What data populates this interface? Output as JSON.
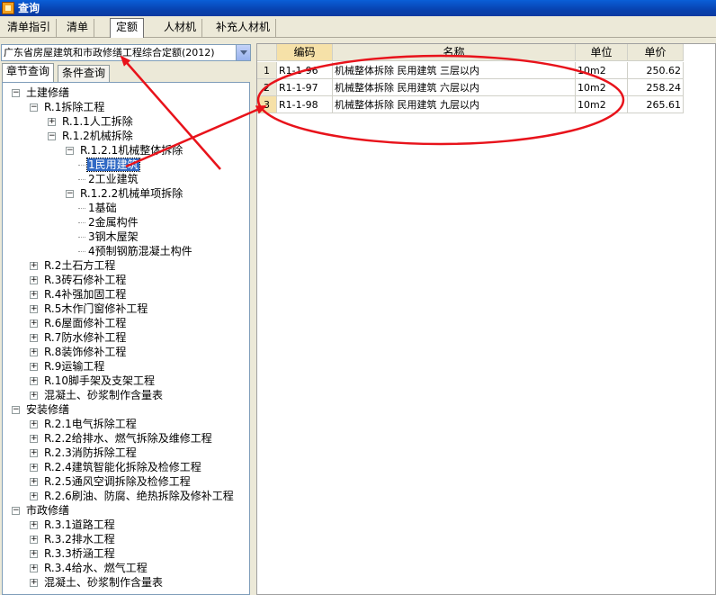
{
  "window": {
    "title": "查询",
    "icon": "app-icon"
  },
  "tabs": [
    "清单指引",
    "清单",
    "定额",
    "人材机",
    "补充人材机"
  ],
  "active_tab": "定额",
  "left": {
    "combo_value": "广东省房屋建筑和市政修缮工程综合定额(2012)",
    "subtabs": [
      "章节查询",
      "条件查询"
    ],
    "tree": [
      {
        "label": "土建修缮",
        "level": 0,
        "box": "-"
      },
      {
        "label": "R.1拆除工程",
        "level": 1,
        "box": "-"
      },
      {
        "label": "R.1.1人工拆除",
        "level": 2,
        "box": "+"
      },
      {
        "label": "R.1.2机械拆除",
        "level": 2,
        "box": "-"
      },
      {
        "label": "R.1.2.1机械整体拆除",
        "level": 3,
        "box": "-"
      },
      {
        "label": "1民用建筑",
        "level": 4,
        "box": "",
        "selected": true
      },
      {
        "label": "2工业建筑",
        "level": 4,
        "box": ""
      },
      {
        "label": "R.1.2.2机械单项拆除",
        "level": 3,
        "box": "-"
      },
      {
        "label": "1基础",
        "level": 4,
        "box": ""
      },
      {
        "label": "2金属构件",
        "level": 4,
        "box": ""
      },
      {
        "label": "3钢木屋架",
        "level": 4,
        "box": ""
      },
      {
        "label": "4预制钢筋混凝土构件",
        "level": 4,
        "box": ""
      },
      {
        "label": "R.2土石方工程",
        "level": 1,
        "box": "+"
      },
      {
        "label": "R.3砖石修补工程",
        "level": 1,
        "box": "+"
      },
      {
        "label": "R.4补强加固工程",
        "level": 1,
        "box": "+"
      },
      {
        "label": "R.5木作门窗修补工程",
        "level": 1,
        "box": "+"
      },
      {
        "label": "R.6屋面修补工程",
        "level": 1,
        "box": "+"
      },
      {
        "label": "R.7防水修补工程",
        "level": 1,
        "box": "+"
      },
      {
        "label": "R.8装饰修补工程",
        "level": 1,
        "box": "+"
      },
      {
        "label": "R.9运输工程",
        "level": 1,
        "box": "+"
      },
      {
        "label": "R.10脚手架及支架工程",
        "level": 1,
        "box": "+"
      },
      {
        "label": "混凝土、砂浆制作含量表",
        "level": 1,
        "box": "+"
      },
      {
        "label": "安装修缮",
        "level": 0,
        "box": "-"
      },
      {
        "label": "R.2.1电气拆除工程",
        "level": 1,
        "box": "+"
      },
      {
        "label": "R.2.2给排水、燃气拆除及维修工程",
        "level": 1,
        "box": "+"
      },
      {
        "label": "R.2.3消防拆除工程",
        "level": 1,
        "box": "+"
      },
      {
        "label": "R.2.4建筑智能化拆除及检修工程",
        "level": 1,
        "box": "+"
      },
      {
        "label": "R.2.5通风空调拆除及检修工程",
        "level": 1,
        "box": "+"
      },
      {
        "label": "R.2.6刷油、防腐、绝热拆除及修补工程",
        "level": 1,
        "box": "+"
      },
      {
        "label": "市政修缮",
        "level": 0,
        "box": "-"
      },
      {
        "label": "R.3.1道路工程",
        "level": 1,
        "box": "+"
      },
      {
        "label": "R.3.2排水工程",
        "level": 1,
        "box": "+"
      },
      {
        "label": "R.3.3桥涵工程",
        "level": 1,
        "box": "+"
      },
      {
        "label": "R.3.4给水、燃气工程",
        "level": 1,
        "box": "+"
      },
      {
        "label": "混凝土、砂浆制作含量表",
        "level": 1,
        "box": "+"
      }
    ]
  },
  "grid": {
    "columns": [
      "编码",
      "名称",
      "单位",
      "单价"
    ],
    "rows": [
      {
        "num": "1",
        "code": "R1-1-96",
        "name": "机械整体拆除 民用建筑 三层以内",
        "unit": "10m2",
        "price": "250.62"
      },
      {
        "num": "2",
        "code": "R1-1-97",
        "name": "机械整体拆除 民用建筑 六层以内",
        "unit": "10m2",
        "price": "258.24"
      },
      {
        "num": "3",
        "code": "R1-1-98",
        "name": "机械整体拆除 民用建筑 九层以内",
        "unit": "10m2",
        "price": "265.61"
      }
    ]
  },
  "colors": {
    "annotation": "#e8131b",
    "selection": "#316ac5",
    "titlebar": "#0842b0"
  }
}
